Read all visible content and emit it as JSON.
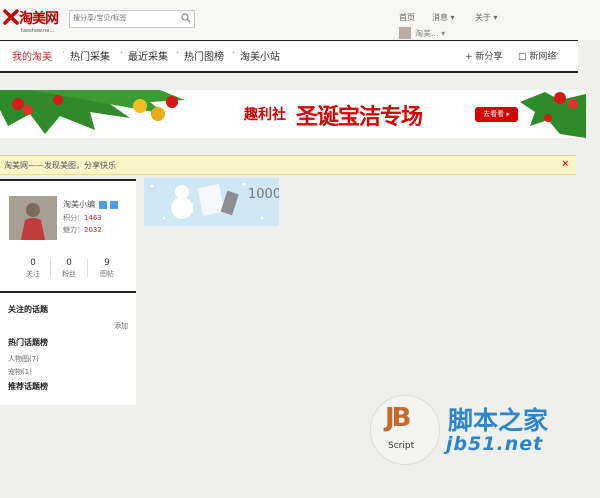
{
  "header": {
    "logo_text": "淘美网",
    "logo_url": "taoshow.ne...",
    "search_placeholder": "搜分享/宝贝/标签",
    "top_links": [
      "首页",
      "消息 ▾",
      "关于 ▾"
    ],
    "user_name": "淘美... ▾"
  },
  "nav": {
    "items": [
      "我的淘美",
      "热门采集",
      "最近采集",
      "热门图榜",
      "淘美小站"
    ],
    "share_label": "+ 新分享",
    "new_link_label": "□ 新网络"
  },
  "banner": {
    "brand": "趣利社",
    "title": "圣诞宝洁专场",
    "button": "去看看 ▸"
  },
  "notice": {
    "text": "淘美网——发现美图，分享快乐",
    "close": "×"
  },
  "profile": {
    "name": "淘美小编",
    "line1_label": "积分：",
    "line1_value": "1463",
    "line2_label": "魅力：",
    "line2_value": "2032",
    "stats": [
      {
        "value": "0",
        "label": "关注"
      },
      {
        "value": "0",
        "label": "粉丝"
      },
      {
        "value": "9",
        "label": "图帖"
      }
    ]
  },
  "promo": {
    "number": "1000"
  },
  "topics": {
    "followed_title": "关注的话题",
    "followed_more": "添加",
    "hot_title": "热门话题榜",
    "hot_items": [
      "人物图(7)",
      "宠物(1)"
    ],
    "recommended_title": "推荐话题榜"
  },
  "watermark": {
    "logo_text": "JB",
    "logo_script": "Script",
    "site_name": "脚本之家",
    "site_url": "jb51.net"
  }
}
